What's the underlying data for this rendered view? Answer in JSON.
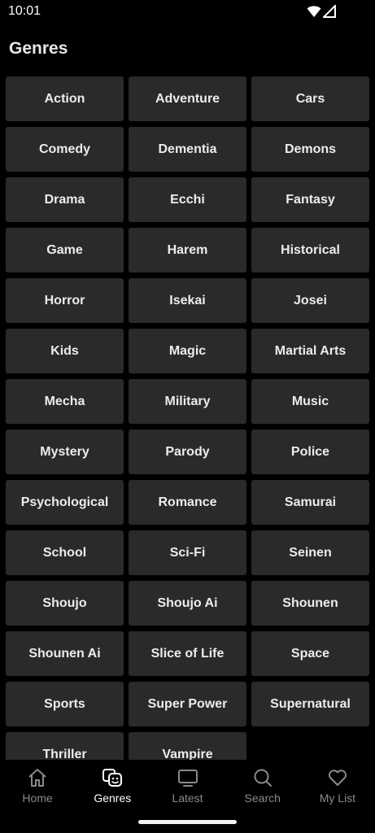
{
  "status": {
    "time": "10:01",
    "icons": [
      "wifi-icon",
      "signal-icon"
    ]
  },
  "page": {
    "title": "Genres"
  },
  "genres": [
    "Action",
    "Adventure",
    "Cars",
    "Comedy",
    "Dementia",
    "Demons",
    "Drama",
    "Ecchi",
    "Fantasy",
    "Game",
    "Harem",
    "Historical",
    "Horror",
    "Isekai",
    "Josei",
    "Kids",
    "Magic",
    "Martial Arts",
    "Mecha",
    "Military",
    "Music",
    "Mystery",
    "Parody",
    "Police",
    "Psychological",
    "Romance",
    "Samurai",
    "School",
    "Sci-Fi",
    "Seinen",
    "Shoujo",
    "Shoujo Ai",
    "Shounen",
    "Shounen Ai",
    "Slice of Life",
    "Space",
    "Sports",
    "Super Power",
    "Supernatural",
    "Thriller",
    "Vampire"
  ],
  "nav": {
    "active": "genres",
    "items": [
      {
        "id": "home",
        "label": "Home",
        "icon": "home-icon"
      },
      {
        "id": "genres",
        "label": "Genres",
        "icon": "genres-icon"
      },
      {
        "id": "latest",
        "label": "Latest",
        "icon": "latest-icon"
      },
      {
        "id": "search",
        "label": "Search",
        "icon": "search-icon"
      },
      {
        "id": "mylist",
        "label": "My List",
        "icon": "heart-icon"
      }
    ]
  },
  "colors": {
    "background": "#000000",
    "tile": "#2a2a2a",
    "inactive": "#8a8a8a",
    "active": "#ffffff"
  }
}
